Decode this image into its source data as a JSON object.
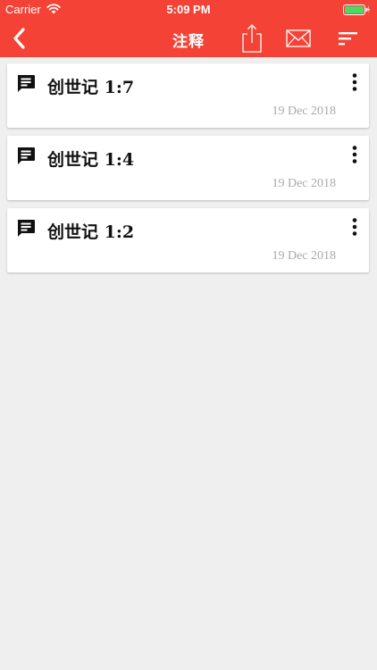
{
  "status_bar": {
    "carrier": "Carrier",
    "time": "5:09 PM",
    "wifi_icon": "wifi-icon",
    "battery_icon": "battery-icon"
  },
  "toolbar": {
    "title": "注释",
    "back_icon": "chevron-left-icon",
    "share_icon": "share-icon",
    "mail_icon": "mail-icon",
    "sort_icon": "sort-icon"
  },
  "colors": {
    "header": "#f44336",
    "background": "#efefef",
    "card": "#ffffff",
    "date_text": "#aaaaaa"
  },
  "notes": [
    {
      "reference": "创世记 1:7",
      "date": "19 Dec 2018",
      "icon": "comment-icon",
      "menu_icon": "more-vertical-icon"
    },
    {
      "reference": "创世记 1:4",
      "date": "19 Dec 2018",
      "icon": "comment-icon",
      "menu_icon": "more-vertical-icon"
    },
    {
      "reference": "创世记 1:2",
      "date": "19 Dec 2018",
      "icon": "comment-icon",
      "menu_icon": "more-vertical-icon"
    }
  ]
}
